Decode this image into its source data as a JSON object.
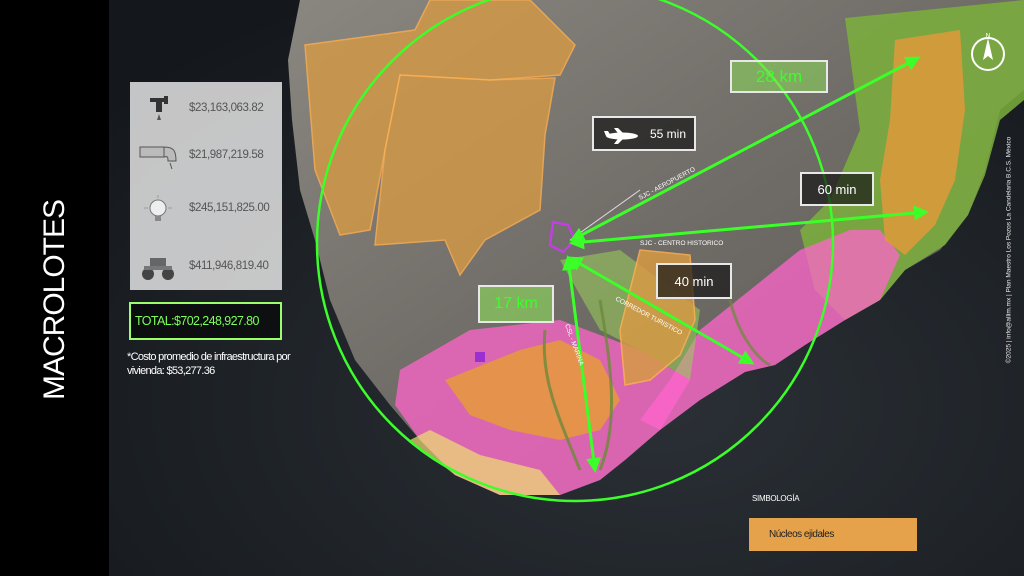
{
  "title": "MACROLOTES",
  "costs": [
    {
      "icon": "faucet-icon",
      "value": "$23,163,063.82"
    },
    {
      "icon": "pipe-icon",
      "value": "$21,987,219.58"
    },
    {
      "icon": "lightbulb-icon",
      "value": "$245,151,825.00"
    },
    {
      "icon": "road-roller-icon",
      "value": "$411,946,819.40"
    }
  ],
  "total": "TOTAL:$702,248,927.80",
  "note": "*Costo promedio de infraestructura por vivienda: $53,277.36",
  "distances": {
    "d28": "28 km",
    "d17": "17 km",
    "t55": "55 min",
    "t60": "60 min",
    "t40": "40 min"
  },
  "road_labels": {
    "aeropuerto": "SJC - AEROPUERTO",
    "centro": "SJC - CENTRO HISTORICO",
    "corredor": "CORREDOR TURISTICO",
    "cabo": "CSL - MARINA"
  },
  "legend": {
    "title": "SIMBOLOGÍA",
    "item": "Núcleos ejidales",
    "item_color": "#e6a24a"
  },
  "compass_label": "N",
  "credit": "©2025 | info@allim.mx | Plan Maestro Los Pozos La Candelaria B.C.S. México",
  "colors": {
    "accent_green": "#3cff2a",
    "ejido_orange": "#e6a24a",
    "urban_pink": "#ff66cc"
  }
}
